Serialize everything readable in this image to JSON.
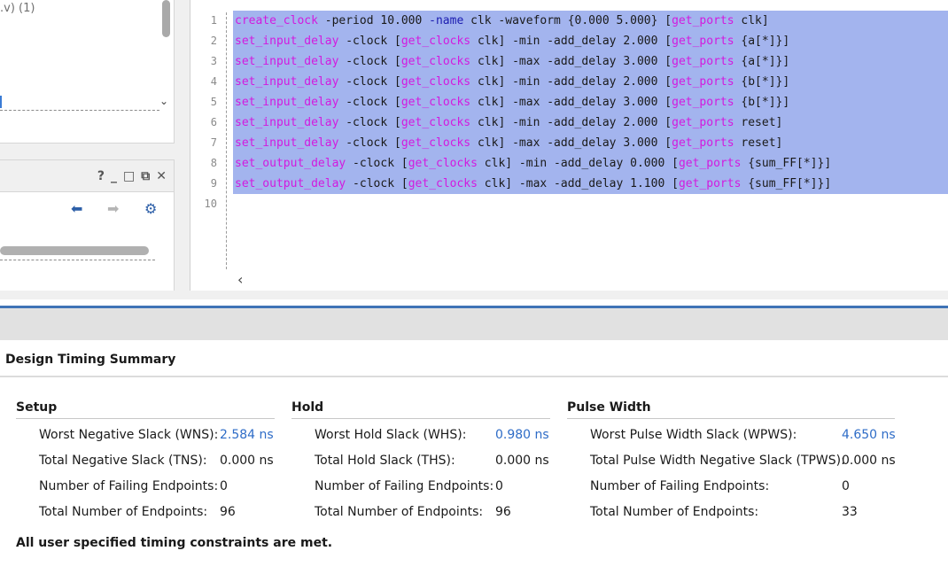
{
  "left_panel": {
    "source_label": ".v) (1)",
    "window_controls": [
      "?",
      "_",
      "□",
      "⧉",
      "✕"
    ],
    "toolbar": {
      "back": "⬅",
      "forward": "➡",
      "settings": "⚙"
    }
  },
  "editor": {
    "line_numbers": [
      "1",
      "2",
      "3",
      "4",
      "5",
      "6",
      "7",
      "8",
      "9",
      "10"
    ],
    "lines": [
      {
        "cmd": "create_clock",
        "rest": " -period 10.000 ",
        "kw": "-name",
        "rest2": " clk -waveform {0.000 5.000} [",
        "cmd2": "get_ports",
        "tail": " clk]"
      },
      {
        "cmd": "set_input_delay",
        "rest": " -clock [",
        "cmd2a": "get_clocks",
        "mid": " clk] -min -add_delay 2.000 [",
        "cmd2": "get_ports",
        "tail": " {a[*]}]"
      },
      {
        "cmd": "set_input_delay",
        "rest": " -clock [",
        "cmd2a": "get_clocks",
        "mid": " clk] -max -add_delay 3.000 [",
        "cmd2": "get_ports",
        "tail": " {a[*]}]"
      },
      {
        "cmd": "set_input_delay",
        "rest": " -clock [",
        "cmd2a": "get_clocks",
        "mid": " clk] -min -add_delay 2.000 [",
        "cmd2": "get_ports",
        "tail": " {b[*]}]"
      },
      {
        "cmd": "set_input_delay",
        "rest": " -clock [",
        "cmd2a": "get_clocks",
        "mid": " clk] -max -add_delay 3.000 [",
        "cmd2": "get_ports",
        "tail": " {b[*]}]"
      },
      {
        "cmd": "set_input_delay",
        "rest": " -clock [",
        "cmd2a": "get_clocks",
        "mid": " clk] -min -add_delay 2.000 [",
        "cmd2": "get_ports",
        "tail": " reset]"
      },
      {
        "cmd": "set_input_delay",
        "rest": " -clock [",
        "cmd2a": "get_clocks",
        "mid": " clk] -max -add_delay 3.000 [",
        "cmd2": "get_ports",
        "tail": " reset]"
      },
      {
        "cmd": "set_output_delay",
        "rest": " -clock [",
        "cmd2a": "get_clocks",
        "mid": " clk] -min -add_delay 0.000 [",
        "cmd2": "get_ports",
        "tail": " {sum_FF[*]}]"
      },
      {
        "cmd": "set_output_delay",
        "rest": " -clock [",
        "cmd2a": "get_clocks",
        "mid": " clk] -max -add_delay 1.100 [",
        "cmd2": "get_ports",
        "tail": " {sum_FF[*]}]"
      },
      {
        "cmd": "",
        "rest": "",
        "cmd2a": "",
        "mid": "",
        "cmd2": "",
        "tail": ""
      }
    ]
  },
  "summary": {
    "title": "Design Timing Summary",
    "setup": {
      "title": "Setup",
      "rows": [
        {
          "label": "Worst Negative Slack (WNS):",
          "value": "2.584 ns"
        },
        {
          "label": "Total Negative Slack (TNS):",
          "value": "0.000 ns"
        },
        {
          "label": "Number of Failing Endpoints:",
          "value": "0"
        },
        {
          "label": "Total Number of Endpoints:",
          "value": "96"
        }
      ]
    },
    "hold": {
      "title": "Hold",
      "rows": [
        {
          "label": "Worst Hold Slack (WHS):",
          "value": "0.980 ns"
        },
        {
          "label": "Total Hold Slack (THS):",
          "value": "0.000 ns"
        },
        {
          "label": "Number of Failing Endpoints:",
          "value": "0"
        },
        {
          "label": "Total Number of Endpoints:",
          "value": "96"
        }
      ]
    },
    "pulse": {
      "title": "Pulse Width",
      "rows": [
        {
          "label": "Worst Pulse Width Slack (WPWS):",
          "value": "4.650 ns"
        },
        {
          "label": "Total Pulse Width Negative Slack (TPWS):",
          "value": "0.000 ns"
        },
        {
          "label": "Number of Failing Endpoints:",
          "value": "0"
        },
        {
          "label": "Total Number of Endpoints:",
          "value": "33"
        }
      ]
    },
    "status": "All user specified timing constraints are met."
  },
  "colors": {
    "link": "#2e6cc7",
    "selection": "#a3b4ee",
    "tcl_command": "#d21adf",
    "tcl_keyword": "#1c1cb0",
    "accent": "#3f73b6"
  }
}
